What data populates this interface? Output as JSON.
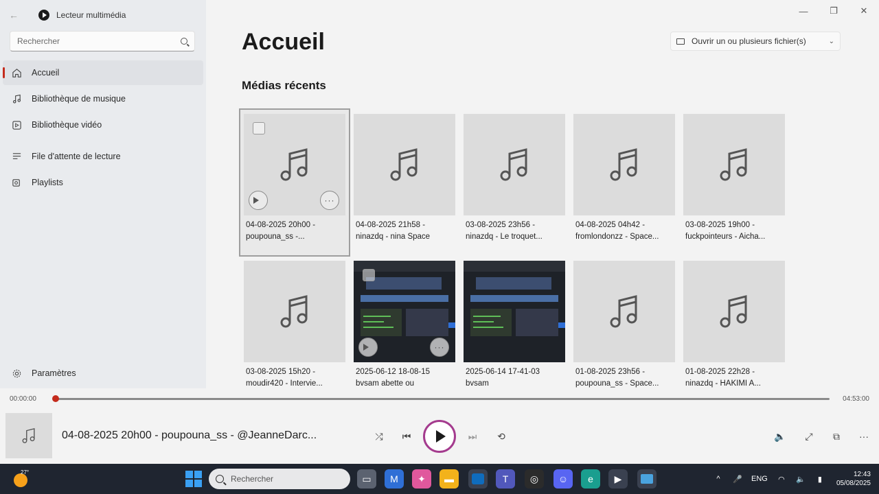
{
  "window": {
    "app_title": "Lecteur multimédia",
    "search_placeholder": "Rechercher",
    "page_title": "Accueil",
    "open_button_label": "Ouvrir un ou plusieurs fichier(s)",
    "section_title": "Médias récents"
  },
  "nav": {
    "items": [
      {
        "label": "Accueil",
        "icon": "home-icon"
      },
      {
        "label": "Bibliothèque de musique",
        "icon": "music-note-icon"
      },
      {
        "label": "Bibliothèque vidéo",
        "icon": "video-icon"
      },
      {
        "label": "File d'attente de lecture",
        "icon": "queue-icon"
      },
      {
        "label": "Playlists",
        "icon": "playlist-icon"
      }
    ],
    "settings_label": "Paramètres"
  },
  "media": [
    {
      "line1": "04-08-2025 20h00 -",
      "line2": "poupouna_ss -...",
      "kind": "audio"
    },
    {
      "line1": "04-08-2025 21h58 -",
      "line2": "ninazdq - nina Space",
      "kind": "audio"
    },
    {
      "line1": "03-08-2025 23h56 -",
      "line2": "ninazdq - Le troquet...",
      "kind": "audio"
    },
    {
      "line1": "04-08-2025 04h42 -",
      "line2": "fromlondonzz - Space...",
      "kind": "audio"
    },
    {
      "line1": "03-08-2025 19h00 -",
      "line2": "fuckpointeurs - Aicha...",
      "kind": "audio"
    },
    {
      "line1": "03-08-2025 15h20 -",
      "line2": "moudir420 - Intervie...",
      "kind": "audio"
    },
    {
      "line1": "2025-06-12 18-08-15",
      "line2": "bvsam abette ou",
      "kind": "video"
    },
    {
      "line1": "2025-06-14 17-41-03",
      "line2": "bvsam",
      "kind": "video"
    },
    {
      "line1": "01-08-2025 23h56 -",
      "line2": "poupouna_ss - Space...",
      "kind": "audio"
    },
    {
      "line1": "01-08-2025 22h28 -",
      "line2": "ninazdq - HAKIMI A...",
      "kind": "audio"
    }
  ],
  "player": {
    "time_elapsed": "00:00:00",
    "time_total": "04:53:00",
    "progress": 0.0,
    "now_playing": "04-08-2025 20h00 - poupouna_ss - @JeanneDarc...",
    "accent_color": "#a43b8e",
    "seek_color": "#c42b1c"
  },
  "taskbar": {
    "temperature": "27°",
    "search_placeholder": "Rechercher",
    "language": "ENG",
    "time": "12:43",
    "date": "05/08/2025"
  }
}
